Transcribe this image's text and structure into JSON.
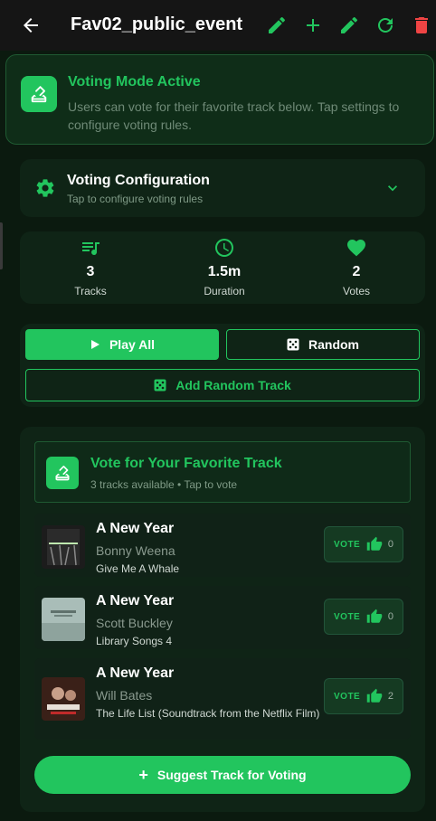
{
  "appbar": {
    "title": "Fav02_public_event",
    "icons": [
      "arrow-back-icon",
      "pencil-icon",
      "plus-icon",
      "pencil-icon",
      "refresh-icon",
      "trash-icon"
    ]
  },
  "banner": {
    "title": "Voting Mode Active",
    "description": "Users can vote for their favorite track below. Tap settings to configure voting rules."
  },
  "config": {
    "title": "Voting Configuration",
    "subtitle": "Tap to configure voting rules"
  },
  "stats": [
    {
      "value": "3",
      "label": "Tracks",
      "icon": "playlist-icon"
    },
    {
      "value": "1.5m",
      "label": "Duration",
      "icon": "clock-icon"
    },
    {
      "value": "2",
      "label": "Votes",
      "icon": "heart-icon"
    }
  ],
  "actions": {
    "play_all": "Play All",
    "random": "Random",
    "add_random": "Add Random Track"
  },
  "vote_section": {
    "title": "Vote for Your Favorite Track",
    "subtitle": "3 tracks available • Tap to vote",
    "vote_label": "VOTE",
    "suggest": "Suggest Track for Voting",
    "tracks": [
      {
        "title": "A New Year",
        "artist": "Bonny Weena",
        "album": "Give Me A Whale",
        "votes": "0"
      },
      {
        "title": "A New Year",
        "artist": "Scott Buckley",
        "album": "Library Songs 4",
        "votes": "0"
      },
      {
        "title": "A New Year",
        "artist": "Will Bates",
        "album": "The Life List (Soundtrack from the Netflix Film)",
        "votes": "2"
      }
    ]
  },
  "colors": {
    "accent": "#22c55e",
    "danger": "#ef4444",
    "background": "#0b1a0f"
  }
}
